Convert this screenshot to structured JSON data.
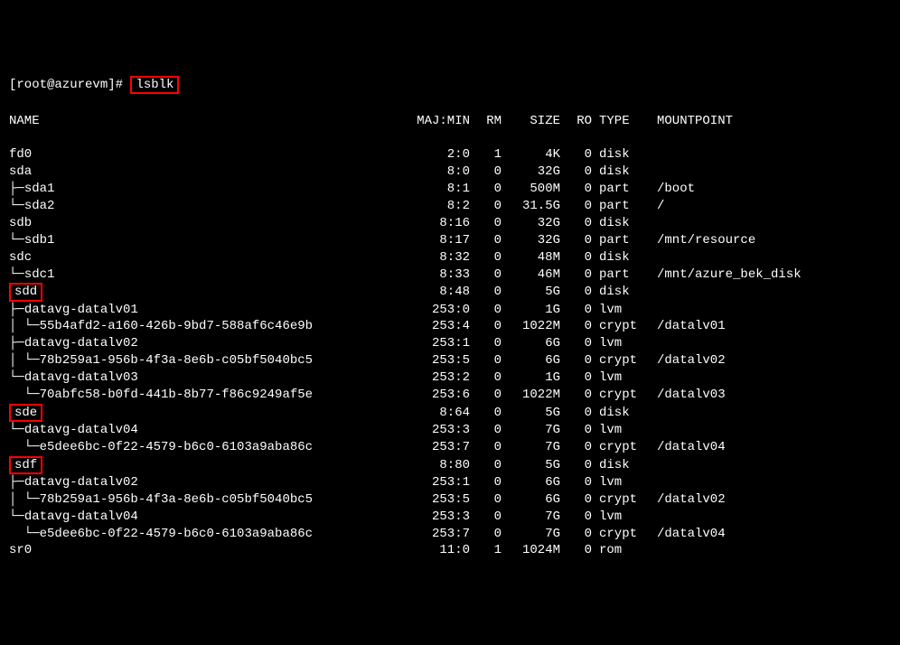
{
  "prompt": "[root@azurevm]#",
  "command": "lsblk",
  "header": {
    "name": "NAME",
    "majmin": "MAJ:MIN",
    "rm": "RM",
    "size": "SIZE",
    "ro": "RO",
    "type": "TYPE",
    "mount": "MOUNTPOINT"
  },
  "rows": [
    {
      "name": "fd0",
      "tree": "",
      "highlight": false,
      "majmin": "2:0",
      "rm": "1",
      "size": "4K",
      "ro": "0",
      "type": "disk",
      "mount": ""
    },
    {
      "name": "sda",
      "tree": "",
      "highlight": false,
      "majmin": "8:0",
      "rm": "0",
      "size": "32G",
      "ro": "0",
      "type": "disk",
      "mount": ""
    },
    {
      "name": "sda1",
      "tree": "├─",
      "highlight": false,
      "majmin": "8:1",
      "rm": "0",
      "size": "500M",
      "ro": "0",
      "type": "part",
      "mount": "/boot"
    },
    {
      "name": "sda2",
      "tree": "└─",
      "highlight": false,
      "majmin": "8:2",
      "rm": "0",
      "size": "31.5G",
      "ro": "0",
      "type": "part",
      "mount": "/"
    },
    {
      "name": "sdb",
      "tree": "",
      "highlight": false,
      "majmin": "8:16",
      "rm": "0",
      "size": "32G",
      "ro": "0",
      "type": "disk",
      "mount": ""
    },
    {
      "name": "sdb1",
      "tree": "└─",
      "highlight": false,
      "majmin": "8:17",
      "rm": "0",
      "size": "32G",
      "ro": "0",
      "type": "part",
      "mount": "/mnt/resource"
    },
    {
      "name": "sdc",
      "tree": "",
      "highlight": false,
      "majmin": "8:32",
      "rm": "0",
      "size": "48M",
      "ro": "0",
      "type": "disk",
      "mount": ""
    },
    {
      "name": "sdc1",
      "tree": "└─",
      "highlight": false,
      "majmin": "8:33",
      "rm": "0",
      "size": "46M",
      "ro": "0",
      "type": "part",
      "mount": "/mnt/azure_bek_disk"
    },
    {
      "name": "sdd",
      "tree": "",
      "highlight": true,
      "majmin": "8:48",
      "rm": "0",
      "size": "5G",
      "ro": "0",
      "type": "disk",
      "mount": ""
    },
    {
      "name": "datavg-datalv01",
      "tree": "├─",
      "highlight": false,
      "majmin": "253:0",
      "rm": "0",
      "size": "1G",
      "ro": "0",
      "type": "lvm",
      "mount": ""
    },
    {
      "name": "55b4afd2-a160-426b-9bd7-588af6c46e9b",
      "tree": "│ └─",
      "highlight": false,
      "majmin": "253:4",
      "rm": "0",
      "size": "1022M",
      "ro": "0",
      "type": "crypt",
      "mount": "/datalv01"
    },
    {
      "name": "datavg-datalv02",
      "tree": "├─",
      "highlight": false,
      "majmin": "253:1",
      "rm": "0",
      "size": "6G",
      "ro": "0",
      "type": "lvm",
      "mount": ""
    },
    {
      "name": "78b259a1-956b-4f3a-8e6b-c05bf5040bc5",
      "tree": "│ └─",
      "highlight": false,
      "majmin": "253:5",
      "rm": "0",
      "size": "6G",
      "ro": "0",
      "type": "crypt",
      "mount": "/datalv02"
    },
    {
      "name": "datavg-datalv03",
      "tree": "└─",
      "highlight": false,
      "majmin": "253:2",
      "rm": "0",
      "size": "1G",
      "ro": "0",
      "type": "lvm",
      "mount": ""
    },
    {
      "name": "70abfc58-b0fd-441b-8b77-f86c9249af5e",
      "tree": "  └─",
      "highlight": false,
      "majmin": "253:6",
      "rm": "0",
      "size": "1022M",
      "ro": "0",
      "type": "crypt",
      "mount": "/datalv03"
    },
    {
      "name": "sde",
      "tree": "",
      "highlight": true,
      "majmin": "8:64",
      "rm": "0",
      "size": "5G",
      "ro": "0",
      "type": "disk",
      "mount": ""
    },
    {
      "name": "datavg-datalv04",
      "tree": "└─",
      "highlight": false,
      "majmin": "253:3",
      "rm": "0",
      "size": "7G",
      "ro": "0",
      "type": "lvm",
      "mount": ""
    },
    {
      "name": "e5dee6bc-0f22-4579-b6c0-6103a9aba86c",
      "tree": "  └─",
      "highlight": false,
      "majmin": "253:7",
      "rm": "0",
      "size": "7G",
      "ro": "0",
      "type": "crypt",
      "mount": "/datalv04"
    },
    {
      "name": "sdf",
      "tree": "",
      "highlight": true,
      "majmin": "8:80",
      "rm": "0",
      "size": "5G",
      "ro": "0",
      "type": "disk",
      "mount": ""
    },
    {
      "name": "datavg-datalv02",
      "tree": "├─",
      "highlight": false,
      "majmin": "253:1",
      "rm": "0",
      "size": "6G",
      "ro": "0",
      "type": "lvm",
      "mount": ""
    },
    {
      "name": "78b259a1-956b-4f3a-8e6b-c05bf5040bc5",
      "tree": "│ └─",
      "highlight": false,
      "majmin": "253:5",
      "rm": "0",
      "size": "6G",
      "ro": "0",
      "type": "crypt",
      "mount": "/datalv02"
    },
    {
      "name": "datavg-datalv04",
      "tree": "└─",
      "highlight": false,
      "majmin": "253:3",
      "rm": "0",
      "size": "7G",
      "ro": "0",
      "type": "lvm",
      "mount": ""
    },
    {
      "name": "e5dee6bc-0f22-4579-b6c0-6103a9aba86c",
      "tree": "  └─",
      "highlight": false,
      "majmin": "253:7",
      "rm": "0",
      "size": "7G",
      "ro": "0",
      "type": "crypt",
      "mount": "/datalv04"
    },
    {
      "name": "sr0",
      "tree": "",
      "highlight": false,
      "majmin": "11:0",
      "rm": "1",
      "size": "1024M",
      "ro": "0",
      "type": "rom",
      "mount": ""
    }
  ]
}
